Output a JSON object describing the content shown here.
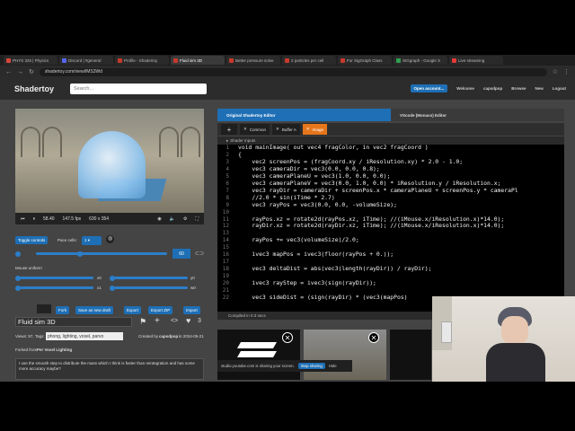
{
  "browser": {
    "tabs": [
      {
        "label": "PHYS 325 | Physics",
        "color": "#d9473c"
      },
      {
        "label": "Discord | #general",
        "color": "#5865f2"
      },
      {
        "label": "Profile - Shadertoy",
        "color": "#c7392b"
      },
      {
        "label": "Fluid sim 3D",
        "color": "#c7392b",
        "active": true
      },
      {
        "label": "Better pressure solve",
        "color": "#c7392b"
      },
      {
        "label": "2 particles per cell",
        "color": "#c7392b"
      },
      {
        "label": "For SigGraph Class",
        "color": "#c7392b"
      },
      {
        "label": "SIGgraph - Google S",
        "color": "#2e9e4f"
      },
      {
        "label": "Live streaming",
        "color": "#e53935"
      }
    ],
    "url": "shadertoy.com/view/lMS3Wd"
  },
  "header": {
    "logo": "Shadertoy",
    "search_placeholder": "Search...",
    "new_account": "Open account...",
    "welcome": "Welcome",
    "username": "capsdpop",
    "browse": "Browse",
    "new": "New",
    "logout": "Logout"
  },
  "player": {
    "time": "58.40",
    "fps": "147.5 fps",
    "resolution": "630 x 354",
    "toggle_controls": "Toggle controls",
    "pace_cells_label": "Pace cells:",
    "pace_cells_value": "1",
    "slider_value": "60",
    "mouse_uniform_label": "Mouse uniform",
    "slider_labels": [
      "x0",
      "y0",
      "x1",
      "w0"
    ]
  },
  "actions": {
    "fork": "Fork",
    "save_draft": "Save as new draft",
    "export": "Export",
    "export_zip": "Export ZIP",
    "import": "Import"
  },
  "shader_info": {
    "title": "Fluid sim 3D",
    "views": "Views: 57, Tags:",
    "tags": "phong, lighting, voxel, parvo",
    "created_by_label": "Created by",
    "author": "capsdpop",
    "date": "in 2024-05-21",
    "likes": "3",
    "forked_from_label": "Forked from",
    "forked_from": "Per Voxel Lighting",
    "description": "I use the smooth step to distribute the mass which I think is faster than reintegration and has some more accuracy maybe?"
  },
  "editor": {
    "tab_original": "Original Shadertoy Editor",
    "tab_vscode": "VScode (Monaco) Editor",
    "buffers": [
      "Common",
      "Buffer A",
      "Image"
    ],
    "shader_inputs": "Shader Inputs",
    "compiled": "Compiled in 0.3 secs",
    "chars": "1130 / 5957 chars",
    "line_numbers": [
      "1",
      "2",
      "3",
      "4",
      "5",
      "6",
      "7",
      "8",
      "9",
      "10",
      "11",
      "12",
      "13",
      "14",
      "15",
      "16",
      "17",
      "18",
      "19",
      "20",
      "21",
      "22"
    ],
    "code_lines": [
      "void mainImage( out vec4 fragColor, in vec2 fragCoord )",
      "{",
      "    vec2 screenPos = (fragCoord.xy / iResolution.xy) * 2.0 - 1.0;",
      "    vec3 cameraDir = vec3(0.0, 0.0, 0.8);",
      "    vec3 cameraPlaneU = vec3(1.0, 0.0, 0.0);",
      "    vec3 cameraPlaneV = vec3(0.0, 1.0, 0.0) * iResolution.y / iResolution.x;",
      "    vec3 rayDir = cameraDir + screenPos.x * cameraPlaneU + screenPos.y * cameraPl",
      "    //2.0 * sin(iTime * 2.7)",
      "    vec3 rayPos = vec3(0.0, 0.0, -volumeSize);",
      "",
      "    rayPos.xz = rotate2d(rayPos.xz, iTime); //(iMouse.x/iResolution.x)*14.0);",
      "    rayDir.xz = rotate2d(rayDir.xz, iTime); //(iMouse.x/iResolution.x)*14.0);",
      "",
      "    rayPos += vec3(volumeSize)/2.0;",
      "",
      "    ivec3 mapPos = ivec3(floor(rayPos + 0.));",
      "",
      "    vec3 deltaDist = abs(vec3(length(rayDir)) / rayDir);",
      "",
      "    ivec3 rayStep = ivec3(sign(rayDir));",
      "",
      "    vec3 sideDist = (sign(rayDir) * (vec3(mapPos) "
    ]
  },
  "screenshare": {
    "text": "studio.youtube.com is sharing your screen.",
    "stop": "Stop sharing",
    "hide": "Hide"
  },
  "colors": {
    "accent": "#1e6fb5",
    "image_tab": "#e6761c",
    "background": "#444444"
  }
}
